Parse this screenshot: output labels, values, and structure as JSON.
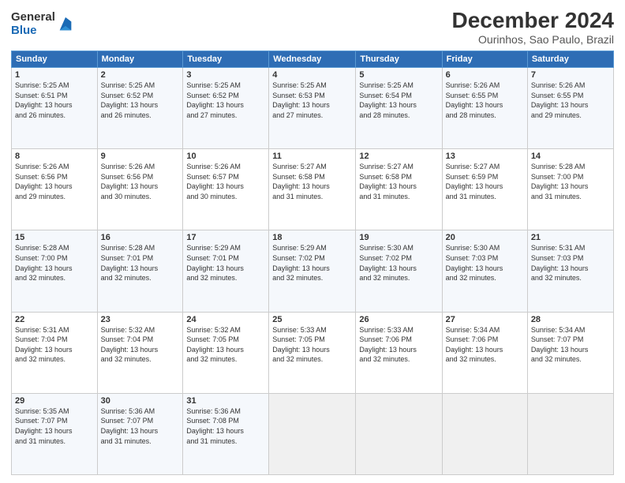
{
  "logo": {
    "general": "General",
    "blue": "Blue"
  },
  "title": "December 2024",
  "subtitle": "Ourinhos, Sao Paulo, Brazil",
  "header_days": [
    "Sunday",
    "Monday",
    "Tuesday",
    "Wednesday",
    "Thursday",
    "Friday",
    "Saturday"
  ],
  "weeks": [
    [
      {
        "day": "1",
        "info": "Sunrise: 5:25 AM\nSunset: 6:51 PM\nDaylight: 13 hours\nand 26 minutes."
      },
      {
        "day": "2",
        "info": "Sunrise: 5:25 AM\nSunset: 6:52 PM\nDaylight: 13 hours\nand 26 minutes."
      },
      {
        "day": "3",
        "info": "Sunrise: 5:25 AM\nSunset: 6:52 PM\nDaylight: 13 hours\nand 27 minutes."
      },
      {
        "day": "4",
        "info": "Sunrise: 5:25 AM\nSunset: 6:53 PM\nDaylight: 13 hours\nand 27 minutes."
      },
      {
        "day": "5",
        "info": "Sunrise: 5:25 AM\nSunset: 6:54 PM\nDaylight: 13 hours\nand 28 minutes."
      },
      {
        "day": "6",
        "info": "Sunrise: 5:26 AM\nSunset: 6:55 PM\nDaylight: 13 hours\nand 28 minutes."
      },
      {
        "day": "7",
        "info": "Sunrise: 5:26 AM\nSunset: 6:55 PM\nDaylight: 13 hours\nand 29 minutes."
      }
    ],
    [
      {
        "day": "8",
        "info": "Sunrise: 5:26 AM\nSunset: 6:56 PM\nDaylight: 13 hours\nand 29 minutes."
      },
      {
        "day": "9",
        "info": "Sunrise: 5:26 AM\nSunset: 6:56 PM\nDaylight: 13 hours\nand 30 minutes."
      },
      {
        "day": "10",
        "info": "Sunrise: 5:26 AM\nSunset: 6:57 PM\nDaylight: 13 hours\nand 30 minutes."
      },
      {
        "day": "11",
        "info": "Sunrise: 5:27 AM\nSunset: 6:58 PM\nDaylight: 13 hours\nand 31 minutes."
      },
      {
        "day": "12",
        "info": "Sunrise: 5:27 AM\nSunset: 6:58 PM\nDaylight: 13 hours\nand 31 minutes."
      },
      {
        "day": "13",
        "info": "Sunrise: 5:27 AM\nSunset: 6:59 PM\nDaylight: 13 hours\nand 31 minutes."
      },
      {
        "day": "14",
        "info": "Sunrise: 5:28 AM\nSunset: 7:00 PM\nDaylight: 13 hours\nand 31 minutes."
      }
    ],
    [
      {
        "day": "15",
        "info": "Sunrise: 5:28 AM\nSunset: 7:00 PM\nDaylight: 13 hours\nand 32 minutes."
      },
      {
        "day": "16",
        "info": "Sunrise: 5:28 AM\nSunset: 7:01 PM\nDaylight: 13 hours\nand 32 minutes."
      },
      {
        "day": "17",
        "info": "Sunrise: 5:29 AM\nSunset: 7:01 PM\nDaylight: 13 hours\nand 32 minutes."
      },
      {
        "day": "18",
        "info": "Sunrise: 5:29 AM\nSunset: 7:02 PM\nDaylight: 13 hours\nand 32 minutes."
      },
      {
        "day": "19",
        "info": "Sunrise: 5:30 AM\nSunset: 7:02 PM\nDaylight: 13 hours\nand 32 minutes."
      },
      {
        "day": "20",
        "info": "Sunrise: 5:30 AM\nSunset: 7:03 PM\nDaylight: 13 hours\nand 32 minutes."
      },
      {
        "day": "21",
        "info": "Sunrise: 5:31 AM\nSunset: 7:03 PM\nDaylight: 13 hours\nand 32 minutes."
      }
    ],
    [
      {
        "day": "22",
        "info": "Sunrise: 5:31 AM\nSunset: 7:04 PM\nDaylight: 13 hours\nand 32 minutes."
      },
      {
        "day": "23",
        "info": "Sunrise: 5:32 AM\nSunset: 7:04 PM\nDaylight: 13 hours\nand 32 minutes."
      },
      {
        "day": "24",
        "info": "Sunrise: 5:32 AM\nSunset: 7:05 PM\nDaylight: 13 hours\nand 32 minutes."
      },
      {
        "day": "25",
        "info": "Sunrise: 5:33 AM\nSunset: 7:05 PM\nDaylight: 13 hours\nand 32 minutes."
      },
      {
        "day": "26",
        "info": "Sunrise: 5:33 AM\nSunset: 7:06 PM\nDaylight: 13 hours\nand 32 minutes."
      },
      {
        "day": "27",
        "info": "Sunrise: 5:34 AM\nSunset: 7:06 PM\nDaylight: 13 hours\nand 32 minutes."
      },
      {
        "day": "28",
        "info": "Sunrise: 5:34 AM\nSunset: 7:07 PM\nDaylight: 13 hours\nand 32 minutes."
      }
    ],
    [
      {
        "day": "29",
        "info": "Sunrise: 5:35 AM\nSunset: 7:07 PM\nDaylight: 13 hours\nand 31 minutes."
      },
      {
        "day": "30",
        "info": "Sunrise: 5:36 AM\nSunset: 7:07 PM\nDaylight: 13 hours\nand 31 minutes."
      },
      {
        "day": "31",
        "info": "Sunrise: 5:36 AM\nSunset: 7:08 PM\nDaylight: 13 hours\nand 31 minutes."
      },
      {
        "day": "",
        "info": ""
      },
      {
        "day": "",
        "info": ""
      },
      {
        "day": "",
        "info": ""
      },
      {
        "day": "",
        "info": ""
      }
    ]
  ]
}
